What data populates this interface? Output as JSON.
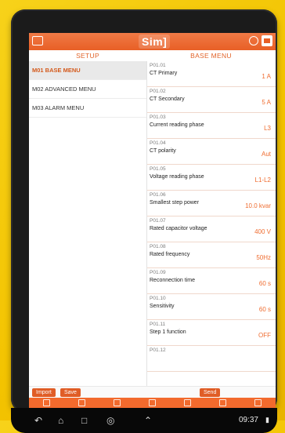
{
  "app": {
    "brand": "Sim]"
  },
  "sections": {
    "left_title": "SETUP",
    "right_title": "BASE MENU"
  },
  "menu": [
    {
      "label": "M01 BASE MENU",
      "active": true
    },
    {
      "label": "M02 ADVANCED MENU",
      "active": false
    },
    {
      "label": "M03 ALARM MENU",
      "active": false
    }
  ],
  "params": [
    {
      "code": "P01.01",
      "name": "CT Primary",
      "value": "1 A"
    },
    {
      "code": "P01.02",
      "name": "CT Secondary",
      "value": "5 A"
    },
    {
      "code": "P01.03",
      "name": "Current reading phase",
      "value": "L3"
    },
    {
      "code": "P01.04",
      "name": "CT polarity",
      "value": "Aut"
    },
    {
      "code": "P01.05",
      "name": "Voltage reading phase",
      "value": "L1-L2"
    },
    {
      "code": "P01.06",
      "name": "Smallest step power",
      "value": "10.0 kvar"
    },
    {
      "code": "P01.07",
      "name": "Rated capacitor voltage",
      "value": "400 V"
    },
    {
      "code": "P01.08",
      "name": "Rated frequency",
      "value": "50Hz"
    },
    {
      "code": "P01.09",
      "name": "Reconnection time",
      "value": "60 s"
    },
    {
      "code": "P01.10",
      "name": "Sensitivity",
      "value": "60 s"
    },
    {
      "code": "P01.11",
      "name": "Step 1 function",
      "value": "OFF"
    },
    {
      "code": "P01.12",
      "name": "",
      "value": ""
    }
  ],
  "buttons": {
    "import": "Import",
    "save": "Save",
    "send": "Send"
  },
  "status": {
    "time": "09:37"
  },
  "colors": {
    "accent": "#e85f26",
    "value": "#ef6d31",
    "menu_active_bg": "#e9e9e9"
  }
}
